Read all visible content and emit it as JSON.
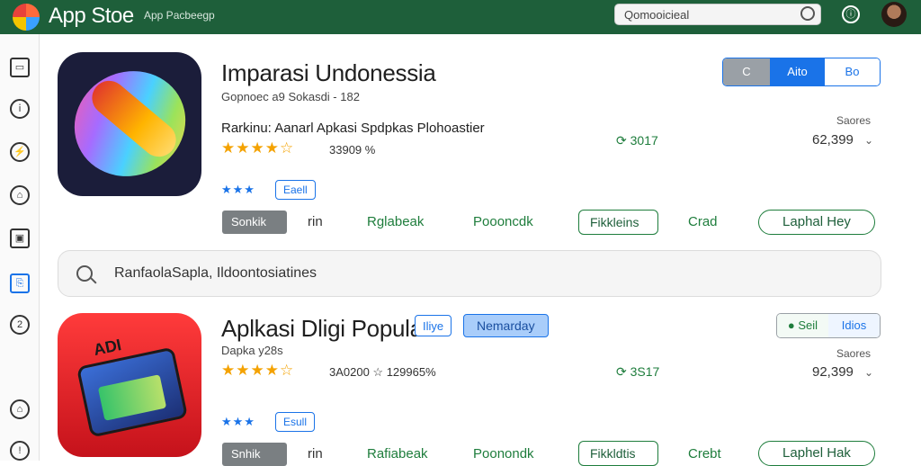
{
  "header": {
    "brand": "App Stoe",
    "brand_sub": "App Pacbeegp",
    "search_value": "Qomooicieal"
  },
  "sidebar": {
    "items": [
      {
        "icon": "layout-icon",
        "glyph": "▭"
      },
      {
        "icon": "info-icon",
        "glyph": "ⅰ"
      },
      {
        "icon": "shield-icon",
        "glyph": "⚡"
      },
      {
        "icon": "home-icon",
        "glyph": "⌂"
      },
      {
        "icon": "image-icon",
        "glyph": "▣"
      },
      {
        "icon": "chat-icon",
        "glyph": "⎘"
      },
      {
        "icon": "number-icon",
        "glyph": "2"
      },
      {
        "icon": "bell-icon",
        "glyph": "⌂"
      },
      {
        "icon": "alert-icon",
        "glyph": "!"
      }
    ]
  },
  "app1": {
    "title": "Imparasi Undonessia",
    "subtitle": "Gopnoec a9 Sokasdi - 182",
    "ranking": "Rarkinu: Aanarl Apkasi Spdpkas Plohoastier",
    "stars": "★★★★☆",
    "rating_text": "33909 %",
    "small_stars": "★★★",
    "chip": "Eaell",
    "install_btn": "Sonkik",
    "link_in": "rin",
    "link_a": "Rglabeak",
    "link_b": "Poooncdk",
    "outline_btn": "Fikkleins",
    "link_c": "Crad",
    "pill_btn": "Laphal Hey",
    "stat": "3017",
    "seg": [
      "C",
      "Aito",
      "Bo"
    ],
    "scores_label": "Saores",
    "scores_value": "62,399"
  },
  "search": {
    "value": "RanfaolaSapla, Ildoontosiatines"
  },
  "app2": {
    "title": "Aplkasi Dligi Popular",
    "tag": "ADI",
    "badge_a": "Iliye",
    "badge_b": "Nemarday",
    "subtitle": "Dapka y28s",
    "stars": "★★★★☆",
    "rating_text": "3A0200 ☆ 129965%",
    "small_stars": "★★★",
    "chip": "Esull",
    "install_btn": "Snhik",
    "link_in": "rin",
    "link_a": "Rafiabeak",
    "link_b": "Poonondk",
    "outline_btn": "Fikkldtis",
    "link_c": "Crebt",
    "pill_btn": "Laphel Hak",
    "stat": "3S17",
    "sell": [
      "Seil",
      "Idios"
    ],
    "scores_label": "Saores",
    "scores_value": "92,399"
  }
}
